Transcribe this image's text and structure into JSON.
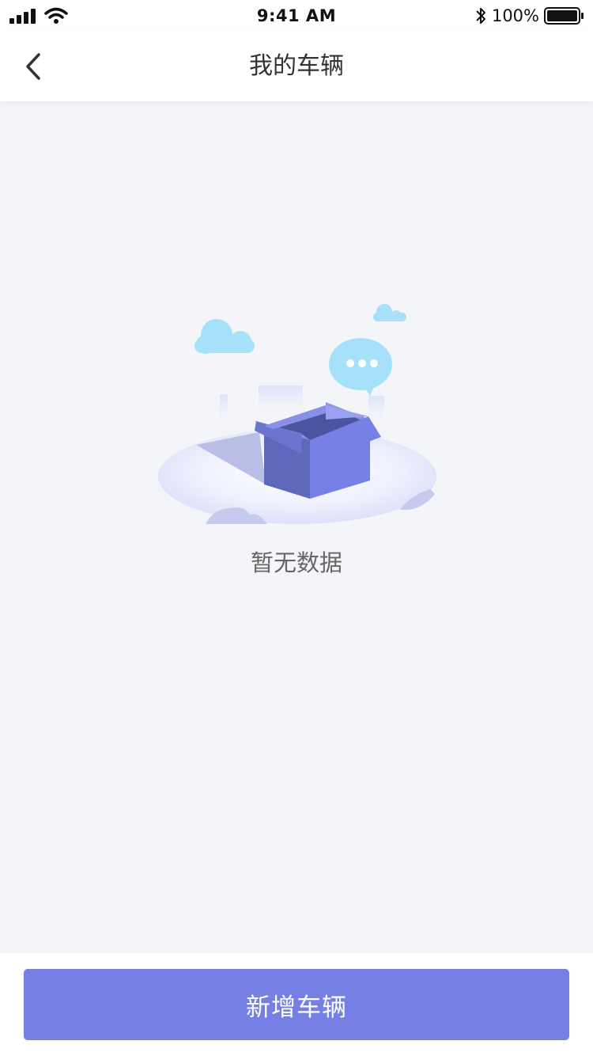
{
  "status_bar": {
    "time": "9:41 AM",
    "battery_percent": "100%",
    "icons": [
      "signal-icon",
      "wifi-icon",
      "bluetooth-icon",
      "battery-icon"
    ]
  },
  "nav": {
    "title": "我的车辆",
    "back_icon": "chevron-left-icon"
  },
  "empty_state": {
    "illustration": "empty-box-icon",
    "message": "暂无数据"
  },
  "footer": {
    "add_button_label": "新增车辆"
  },
  "colors": {
    "primary": "#7680e4",
    "background": "#f4f5f9",
    "cloud": "#a6e1f9"
  }
}
